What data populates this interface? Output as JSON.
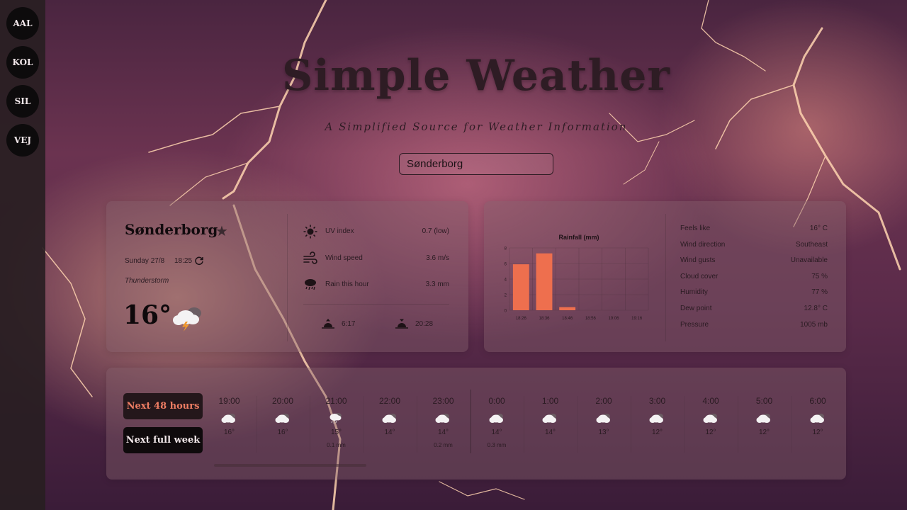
{
  "sidebar": {
    "cities": [
      "AAL",
      "KOL",
      "SIL",
      "VEJ"
    ]
  },
  "header": {
    "title": "Simple Weather",
    "subtitle": "A Simplified Source for Weather Information"
  },
  "search": {
    "value": "Sønderborg"
  },
  "current": {
    "city": "Sønderborg",
    "date": "Sunday 27/8",
    "time": "18:25",
    "condition": "Thunderstorm",
    "temperature": "16°",
    "stats": [
      {
        "icon": "sun-icon",
        "label": "UV index",
        "value": "0.7 (low)"
      },
      {
        "icon": "wind-icon",
        "label": "Wind speed",
        "value": "3.6 m/s"
      },
      {
        "icon": "rain-cloud-icon",
        "label": "Rain this hour",
        "value": "3.3 mm"
      }
    ],
    "sunrise": "6:17",
    "sunset": "20:28"
  },
  "details": {
    "rows": [
      {
        "label": "Feels like",
        "value": "16° C"
      },
      {
        "label": "Wind direction",
        "value": "Southeast"
      },
      {
        "label": "Wind gusts",
        "value": "Unavailable"
      },
      {
        "label": "Cloud cover",
        "value": "75 %"
      },
      {
        "label": "Humidity",
        "value": "77 %"
      },
      {
        "label": "Dew point",
        "value": "12.8° C"
      },
      {
        "label": "Pressure",
        "value": "1005 mb"
      }
    ]
  },
  "chart_data": {
    "type": "bar",
    "title": "Rainfall (mm)",
    "categories": [
      "18:26",
      "18:36",
      "18:46",
      "18:56",
      "19:06",
      "19:16"
    ],
    "values": [
      5.9,
      7.3,
      0.4,
      0,
      0,
      0
    ],
    "ylim": [
      0,
      8
    ],
    "yticks": [
      0,
      2,
      4,
      6,
      8
    ],
    "grid": true,
    "color": "#ee6f4e"
  },
  "forecast": {
    "buttons": {
      "next48": "Next 48 hours",
      "week": "Next full week"
    },
    "hours": [
      {
        "time": "19:00",
        "icon": "cloud-icon",
        "temp": "16°",
        "rain": ""
      },
      {
        "time": "20:00",
        "icon": "cloud-icon",
        "temp": "16°",
        "rain": ""
      },
      {
        "time": "21:00",
        "icon": "rain-cloud-icon",
        "temp": "15°",
        "rain": "0.1 mm"
      },
      {
        "time": "22:00",
        "icon": "cloud-icon",
        "temp": "14°",
        "rain": ""
      },
      {
        "time": "23:00",
        "icon": "cloud-icon",
        "temp": "14°",
        "rain": "0.2 mm"
      },
      {
        "time": "0:00",
        "icon": "cloud-icon",
        "temp": "14°",
        "rain": "0.3 mm"
      },
      {
        "time": "1:00",
        "icon": "cloud-icon",
        "temp": "14°",
        "rain": ""
      },
      {
        "time": "2:00",
        "icon": "cloud-icon",
        "temp": "13°",
        "rain": ""
      },
      {
        "time": "3:00",
        "icon": "cloud-icon",
        "temp": "12°",
        "rain": ""
      },
      {
        "time": "4:00",
        "icon": "cloud-icon",
        "temp": "12°",
        "rain": ""
      },
      {
        "time": "5:00",
        "icon": "cloud-icon",
        "temp": "12°",
        "rain": ""
      },
      {
        "time": "6:00",
        "icon": "cloud-icon",
        "temp": "12°",
        "rain": ""
      }
    ]
  }
}
